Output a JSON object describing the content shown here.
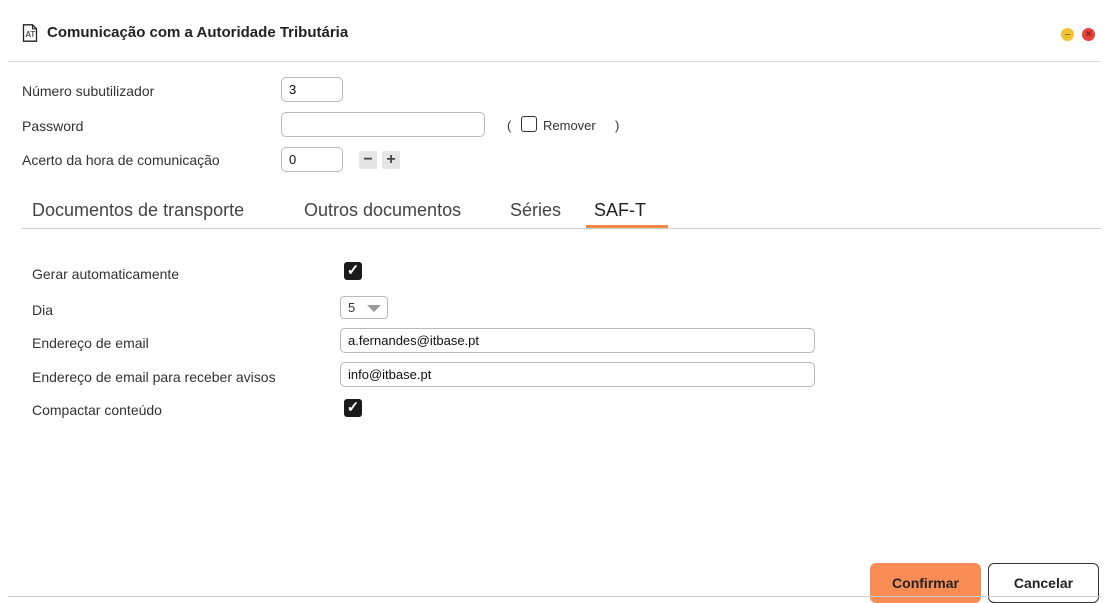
{
  "window": {
    "title": "Comunicação com a Autoridade Tributária",
    "icon": "document-icon",
    "minimize_color": "#f1c232",
    "close_color": "#e8413c"
  },
  "form": {
    "subuser": {
      "label": "Número subutilizador",
      "value": "3"
    },
    "password": {
      "label": "Password",
      "value": "",
      "remove_open": "(",
      "remove_label": "Remover",
      "remove_close": ")",
      "remove_checked": false
    },
    "time_offset": {
      "label": "Acerto da hora de comunicação",
      "value": "0",
      "minus": "−",
      "plus": "+"
    }
  },
  "tabs": [
    {
      "label": "Documentos de transporte",
      "active": false
    },
    {
      "label": "Outros documentos",
      "active": false
    },
    {
      "label": "Séries",
      "active": false
    },
    {
      "label": "SAF-T",
      "active": true
    }
  ],
  "saft": {
    "auto_generate": {
      "label": "Gerar automaticamente",
      "checked": true,
      "mark": "✓"
    },
    "day": {
      "label": "Dia",
      "value": "5"
    },
    "email": {
      "label": "Endereço de email",
      "value": "a.fernandes@itbase.pt"
    },
    "notify_email": {
      "label": "Endereço de email para receber avisos",
      "value": "info@itbase.pt"
    },
    "compress": {
      "label": "Compactar conteúdo",
      "checked": true,
      "mark": "✓"
    }
  },
  "buttons": {
    "confirm": "Confirmar",
    "cancel": "Cancelar"
  },
  "accent_color": "#f08a4b"
}
